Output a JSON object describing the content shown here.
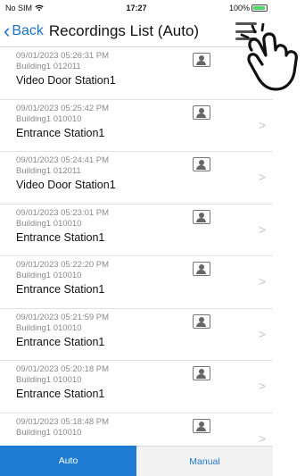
{
  "status": {
    "carrier": "No SIM",
    "time": "17:27",
    "battery": "100%"
  },
  "nav": {
    "back_label": "Back",
    "title": "Recordings List (Auto)"
  },
  "recordings": [
    {
      "timestamp": "09/01/2023 05:26:31 PM",
      "building": "Building1 012011",
      "device": "Video Door Station1"
    },
    {
      "timestamp": "09/01/2023 05:25:42 PM",
      "building": "Building1 010010",
      "device": "Entrance Station1"
    },
    {
      "timestamp": "09/01/2023 05:24:41 PM",
      "building": "Building1 012011",
      "device": "Video Door Station1"
    },
    {
      "timestamp": "09/01/2023 05:23:01 PM",
      "building": "Building1 010010",
      "device": "Entrance Station1"
    },
    {
      "timestamp": "09/01/2023 05:22:20 PM",
      "building": "Building1 010010",
      "device": "Entrance Station1"
    },
    {
      "timestamp": "09/01/2023 05:21:59 PM",
      "building": "Building1 010010",
      "device": "Entrance Station1"
    },
    {
      "timestamp": "09/01/2023 05:20:18 PM",
      "building": "Building1 010010",
      "device": "Entrance Station1"
    },
    {
      "timestamp": "09/01/2023 05:18:48 PM",
      "building": "Building1 010010",
      "device": ""
    }
  ],
  "tabs": {
    "auto_label": "Auto",
    "manual_label": "Manual"
  },
  "colors": {
    "accent": "#1f7bd1"
  },
  "icons": {
    "row_icon": "video-recording-icon",
    "menu": "hamburger-menu-icon",
    "pointer": "tap-hand-icon"
  }
}
